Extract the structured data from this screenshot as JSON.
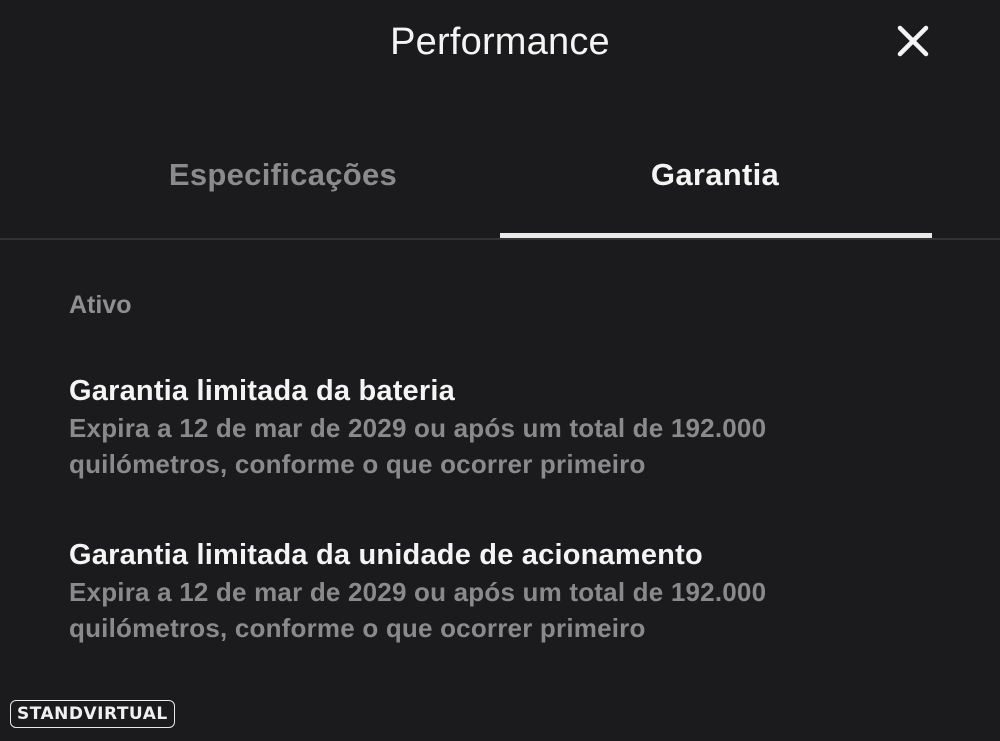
{
  "header": {
    "title": "Performance"
  },
  "tabs": [
    {
      "label": "Especificações",
      "active": false
    },
    {
      "label": "Garantia",
      "active": true
    }
  ],
  "status_label": "Ativo",
  "warranties": [
    {
      "title": "Garantia limitada da bateria",
      "description": "Expira a 12 de mar de 2029 ou após um total de 192.000 quilómetros, conforme o que ocorrer primeiro"
    },
    {
      "title": "Garantia limitada da unidade de acionamento",
      "description": "Expira a 12 de mar de 2029 ou após um total de 192.000 quilómetros, conforme o que ocorrer primeiro"
    }
  ],
  "watermark": {
    "text": "STANDVIRTUAL"
  },
  "colors": {
    "background": "#1b1b1d",
    "text_primary": "#f4f4f4",
    "text_secondary": "#8a8a8c",
    "tab_indicator": "#e9e9e9"
  }
}
